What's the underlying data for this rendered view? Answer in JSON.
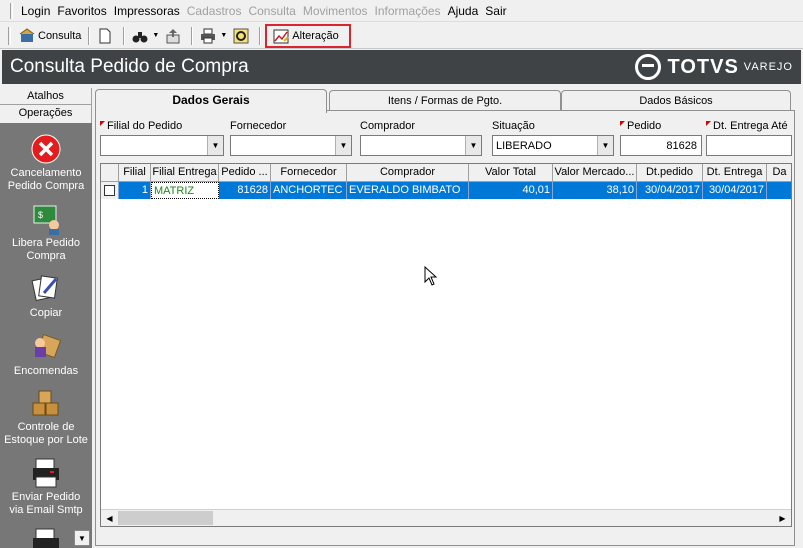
{
  "menu": {
    "items": [
      {
        "label": "Login",
        "disabled": false
      },
      {
        "label": "Favoritos",
        "disabled": false
      },
      {
        "label": "Impressoras",
        "disabled": false
      },
      {
        "label": "Cadastros",
        "disabled": true
      },
      {
        "label": "Consulta",
        "disabled": true
      },
      {
        "label": "Movimentos",
        "disabled": true
      },
      {
        "label": "Informações",
        "disabled": true
      },
      {
        "label": "Ajuda",
        "disabled": false
      },
      {
        "label": "Sair",
        "disabled": false
      }
    ]
  },
  "toolbar": {
    "consulta_label": "Consulta",
    "alteracao_label": "Alteração",
    "highlight_color": "#d9262c"
  },
  "window": {
    "title": "Consulta Pedido de Compra",
    "brand": "TOTVS",
    "brand_sub": "VAREJO",
    "title_bg": "#3f4346"
  },
  "sidebar": {
    "tabs": [
      "Atalhos",
      "Operações"
    ],
    "items": [
      {
        "label": "Cancelamento Pedido Compra",
        "icon": "cancel-icon"
      },
      {
        "label": "Libera Pedido Compra",
        "icon": "release-order-icon"
      },
      {
        "label": "Copiar",
        "icon": "copy-icon"
      },
      {
        "label": "Encomendas",
        "icon": "orders-icon"
      },
      {
        "label": "Controle de Estoque por Lote",
        "icon": "stock-boxes-icon"
      },
      {
        "label": "Enviar Pedido via Email Smtp",
        "icon": "email-printer-icon"
      }
    ]
  },
  "tabs": [
    "Dados Gerais",
    "Itens / Formas de Pgto.",
    "Dados Básicos"
  ],
  "filters": {
    "filial_label": "Filial do Pedido",
    "filial_value": "",
    "fornecedor_label": "Fornecedor",
    "fornecedor_value": "",
    "comprador_label": "Comprador",
    "comprador_value": "",
    "situacao_label": "Situação",
    "situacao_value": "LIBERADO",
    "pedido_label": "Pedido",
    "pedido_value": "81628",
    "dt_entrega_label": "Dt. Entrega Até",
    "dt_entrega_value": ""
  },
  "grid": {
    "columns": [
      "Filial",
      "Filial Entrega",
      "Pedido ...",
      "Fornecedor",
      "Comprador",
      "Valor Total",
      "Valor Mercado...",
      "Dt.pedido",
      "Dt. Entrega",
      "Da"
    ],
    "rows": [
      {
        "checked": true,
        "cells": [
          "1",
          "MATRIZ",
          "81628",
          "ANCHORTEC",
          "EVERALDO BIMBATO",
          "40,01",
          "38,10",
          "30/04/2017",
          "30/04/2017",
          ""
        ]
      }
    ],
    "selection_color": "#0078d7"
  }
}
